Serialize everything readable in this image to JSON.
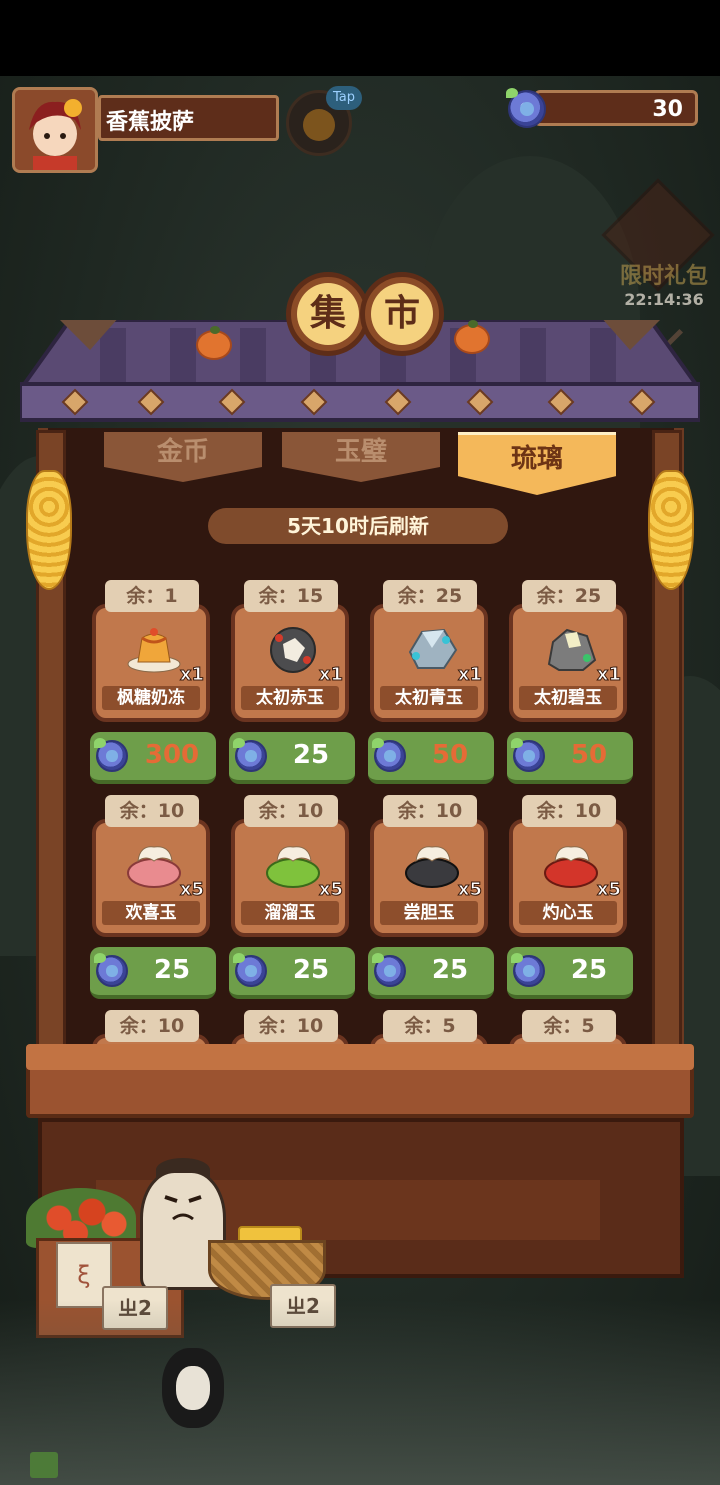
{
  "player": {
    "name": "香蕉披萨"
  },
  "header": {
    "tap_label": "Tap",
    "currency_amount": "30"
  },
  "limited_offer": {
    "label": "限时礼包",
    "timer": "22:14:36"
  },
  "market": {
    "title_chars": [
      "集",
      "市"
    ],
    "tabs": [
      {
        "label": "金币",
        "active": false
      },
      {
        "label": "玉璧",
        "active": false
      },
      {
        "label": "琉璃",
        "active": true
      }
    ],
    "refresh_text": "5天10时后刷新",
    "items": [
      {
        "stock": "余：1",
        "name": "枫糖奶冻",
        "qty": "x1",
        "price": "300",
        "affordable": false,
        "art": "pudding"
      },
      {
        "stock": "余：15",
        "name": "太初赤玉",
        "qty": "x1",
        "price": "25",
        "affordable": true,
        "art": "red-ore"
      },
      {
        "stock": "余：25",
        "name": "太初青玉",
        "qty": "x1",
        "price": "50",
        "affordable": false,
        "art": "blue-ore"
      },
      {
        "stock": "余：25",
        "name": "太初碧玉",
        "qty": "x1",
        "price": "50",
        "affordable": false,
        "art": "green-ore"
      },
      {
        "stock": "余：10",
        "name": "欢喜玉",
        "qty": "x5",
        "price": "25",
        "affordable": true,
        "art": "pink-jade"
      },
      {
        "stock": "余：10",
        "name": "溜溜玉",
        "qty": "x5",
        "price": "25",
        "affordable": true,
        "art": "green-jade"
      },
      {
        "stock": "余：10",
        "name": "尝胆玉",
        "qty": "x5",
        "price": "25",
        "affordable": true,
        "art": "black-jade"
      },
      {
        "stock": "余：10",
        "name": "灼心玉",
        "qty": "x5",
        "price": "25",
        "affordable": true,
        "art": "red-jade"
      },
      {
        "stock": "余：10",
        "name": "",
        "qty": "",
        "price": "",
        "affordable": true,
        "art": ""
      },
      {
        "stock": "余：10",
        "name": "",
        "qty": "",
        "price": "",
        "affordable": true,
        "art": ""
      },
      {
        "stock": "余：5",
        "name": "",
        "qty": "",
        "price": "",
        "affordable": true,
        "art": ""
      },
      {
        "stock": "余：5",
        "name": "",
        "qty": "",
        "price": "",
        "affordable": true,
        "art": ""
      }
    ]
  },
  "stall_signs": {
    "sign1": "ㄓ2",
    "sign2": "ㄓ2",
    "tall_sign": "ξ"
  },
  "colors": {
    "price_ok": "#ffffff",
    "price_short": "#e56b36",
    "button_green": "#6e9e4a",
    "card_brown": "#c1784c"
  }
}
